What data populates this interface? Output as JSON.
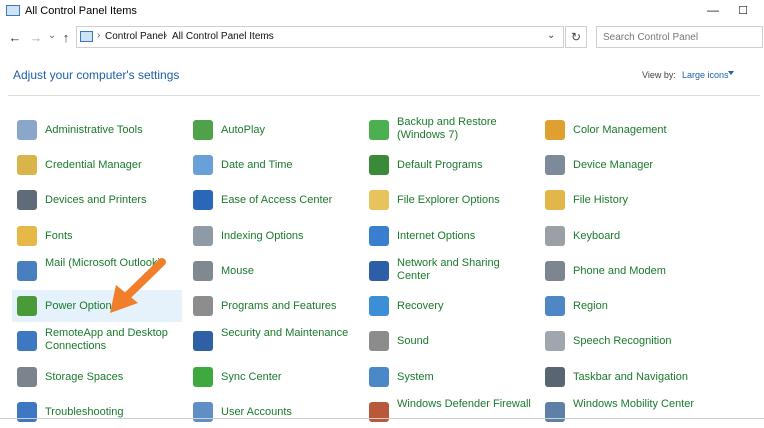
{
  "window": {
    "title": "All Control Panel Items",
    "min_glyph": "—",
    "max_glyph": "☐"
  },
  "nav": {
    "back": "←",
    "forward": "→",
    "recent": "⌄",
    "up": "↑",
    "refresh": "↻",
    "dropdown": "⌄"
  },
  "breadcrumb": [
    "Control Panel",
    "All Control Panel Items"
  ],
  "breadcrumb_sep": "›",
  "search": {
    "placeholder": "Search Control Panel"
  },
  "heading": "Adjust your computer's settings",
  "view_by": {
    "label": "View by:",
    "value": "Large icons"
  },
  "items": [
    {
      "label": "Administrative Tools",
      "icon": "admin-tools-icon",
      "color": "#8aa7c9"
    },
    {
      "label": "AutoPlay",
      "icon": "autoplay-icon",
      "color": "#4fa24a"
    },
    {
      "label": "Backup and Restore (Windows 7)",
      "icon": "backup-restore-icon",
      "color": "#4caf50"
    },
    {
      "label": "Color Management",
      "icon": "color-management-icon",
      "color": "#e0a030"
    },
    {
      "label": "Credential Manager",
      "icon": "credential-manager-icon",
      "color": "#d8b44a"
    },
    {
      "label": "Date and Time",
      "icon": "date-time-icon",
      "color": "#6aa0d8"
    },
    {
      "label": "Default Programs",
      "icon": "default-programs-icon",
      "color": "#3a8a3a"
    },
    {
      "label": "Device Manager",
      "icon": "device-manager-icon",
      "color": "#7c8a99"
    },
    {
      "label": "Devices and Printers",
      "icon": "devices-printers-icon",
      "color": "#5f6b78"
    },
    {
      "label": "Ease of Access Center",
      "icon": "ease-of-access-icon",
      "color": "#2a67b8"
    },
    {
      "label": "File Explorer Options",
      "icon": "file-explorer-options-icon",
      "color": "#e8c25a"
    },
    {
      "label": "File History",
      "icon": "file-history-icon",
      "color": "#e3b64a"
    },
    {
      "label": "Fonts",
      "icon": "fonts-icon",
      "color": "#e6b84a"
    },
    {
      "label": "Indexing Options",
      "icon": "indexing-options-icon",
      "color": "#8e9aa6"
    },
    {
      "label": "Internet Options",
      "icon": "internet-options-icon",
      "color": "#3a7fcf"
    },
    {
      "label": "Keyboard",
      "icon": "keyboard-icon",
      "color": "#9aa0a6"
    },
    {
      "label": "Mail (Microsoft Outlook)",
      "icon": "mail-icon",
      "color": "#4a7fbf"
    },
    {
      "label": "Mouse",
      "icon": "mouse-icon",
      "color": "#808890"
    },
    {
      "label": "Network and Sharing Center",
      "icon": "network-sharing-icon",
      "color": "#2d5fa8"
    },
    {
      "label": "Phone and Modem",
      "icon": "phone-modem-icon",
      "color": "#7d8590"
    },
    {
      "label": "Power Options",
      "icon": "power-options-icon",
      "color": "#4a9a3a"
    },
    {
      "label": "Programs and Features",
      "icon": "programs-features-icon",
      "color": "#8d8d8d"
    },
    {
      "label": "Recovery",
      "icon": "recovery-icon",
      "color": "#3c8fd6"
    },
    {
      "label": "Region",
      "icon": "region-icon",
      "color": "#4f86c4"
    },
    {
      "label": "RemoteApp and Desktop Connections",
      "icon": "remoteapp-icon",
      "color": "#3e78c0"
    },
    {
      "label": "Security and Maintenance",
      "icon": "security-maintenance-icon",
      "color": "#2f5fa5"
    },
    {
      "label": "Sound",
      "icon": "sound-icon",
      "color": "#8c8c8c"
    },
    {
      "label": "Speech Recognition",
      "icon": "speech-recognition-icon",
      "color": "#a0a6ad"
    },
    {
      "label": "Storage Spaces",
      "icon": "storage-spaces-icon",
      "color": "#7b848d"
    },
    {
      "label": "Sync Center",
      "icon": "sync-center-icon",
      "color": "#3fa83f"
    },
    {
      "label": "System",
      "icon": "system-icon",
      "color": "#4a88c8"
    },
    {
      "label": "Taskbar and Navigation",
      "icon": "taskbar-navigation-icon",
      "color": "#5a6572"
    },
    {
      "label": "Troubleshooting",
      "icon": "troubleshooting-icon",
      "color": "#3f78c2"
    },
    {
      "label": "User Accounts",
      "icon": "user-accounts-icon",
      "color": "#5f8fc4"
    },
    {
      "label": "Windows Defender Firewall",
      "icon": "firewall-icon",
      "color": "#b85a3a"
    },
    {
      "label": "Windows Mobility Center",
      "icon": "mobility-center-icon",
      "color": "#5e7fa6"
    }
  ],
  "hover_item": "Power Options",
  "annotation_arrow_color": "#f07e2a"
}
